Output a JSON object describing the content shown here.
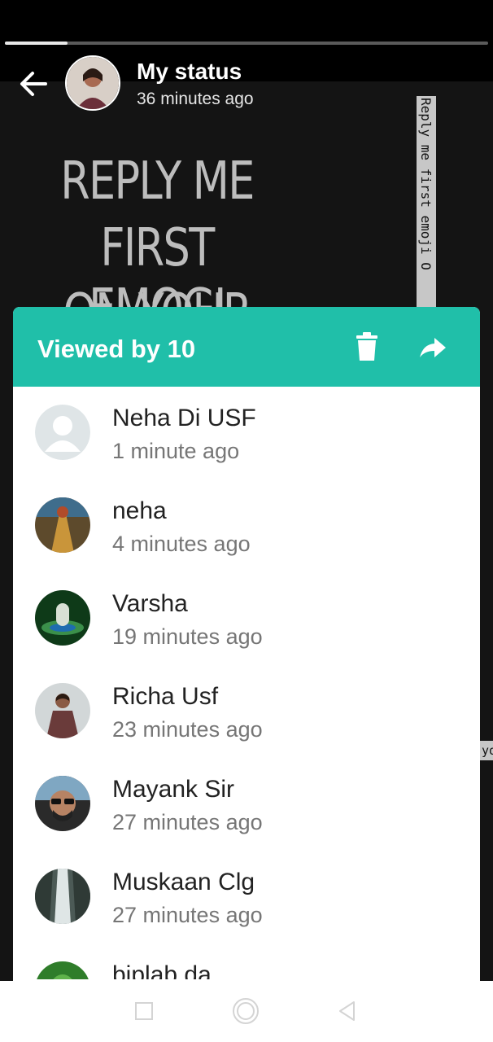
{
  "story": {
    "progress": 0.13,
    "title": "My status",
    "subtitle": "36 minutes ago",
    "text_lines": [
      "REPLY ME",
      "FIRST EMOGI",
      "ON YOUR"
    ],
    "vertical_caption": "Reply me first emoji O",
    "side_snippet": "yo"
  },
  "sheet": {
    "title": "Viewed by 10",
    "viewers": [
      {
        "name": "Neha Di USF",
        "time": "1 minute ago"
      },
      {
        "name": "neha",
        "time": "4 minutes ago"
      },
      {
        "name": "Varsha",
        "time": "19 minutes ago"
      },
      {
        "name": "Richa Usf",
        "time": "23 minutes ago"
      },
      {
        "name": "Mayank Sir",
        "time": "27 minutes ago"
      },
      {
        "name": "Muskaan Clg",
        "time": "27 minutes ago"
      },
      {
        "name": "biplab da",
        "time": ""
      }
    ]
  },
  "colors": {
    "accent": "#20bfa9"
  },
  "icons": [
    "back-arrow-icon",
    "trash-icon",
    "forward-arrow-icon",
    "recent-apps-icon",
    "home-icon",
    "back-triangle-icon"
  ]
}
